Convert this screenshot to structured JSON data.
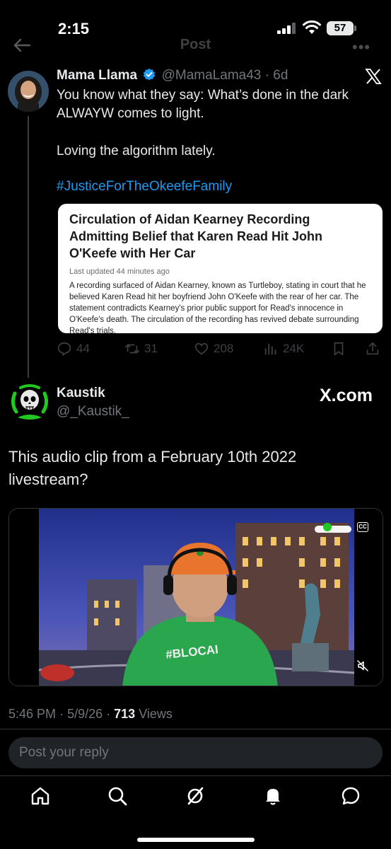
{
  "status_bar": {
    "time": "2:15",
    "battery": "57"
  },
  "topbar": {
    "title": "Post",
    "back_icon": "back-arrow-icon",
    "more_icon": "more-dots-icon"
  },
  "quoted_post": {
    "name": "Mama Llama",
    "handle": "@MamaLama43",
    "separator": "·",
    "age": "6d",
    "text_lines": [
      "You know what they say: What’s done in the dark",
      "ALWAYW comes to light."
    ],
    "text_2": "Loving the algorithm lately.",
    "hashtag": "#JusticeForTheOkeefeFamily",
    "card": {
      "title": "Circulation of Aidan Kearney Recording Admitting Belief that Karen Read Hit John O'Keefe with Her Car",
      "updated": "Last updated 44 minutes ago",
      "body": "A recording surfaced of Aidan Kearney, known as Turtleboy, stating in court that he believed Karen Read hit her boyfriend John O'Keefe with the rear of her car. The statement contradicts Kearney's prior public support for Read's innocence in O'Keefe's death. The circulation of the recording has revived debate surrounding Read's trials."
    },
    "actions": {
      "replies": "44",
      "reposts": "31",
      "likes": "208",
      "views": "24K"
    }
  },
  "main_post": {
    "name": "Kaustik",
    "handle": "@_Kaustik_",
    "source": "X.com",
    "text_lines": [
      "This audio clip from a February 10th 2022",
      "livestream?"
    ],
    "video": {
      "shirt_text": "#BLOCAI",
      "cc_label": "CC"
    },
    "time": "5:46 PM",
    "date": "5/9/26",
    "views_count": "713",
    "views_label": "Views",
    "separator": "·"
  },
  "reply": {
    "placeholder": "Post your reply"
  },
  "tabbar": {
    "items": [
      "home-icon",
      "search-icon",
      "grok-icon",
      "notifications-icon",
      "messages-icon"
    ]
  },
  "colors": {
    "background": "#000000",
    "text": "#e7e9ea",
    "muted": "#71767b",
    "accent": "#1d9bf0",
    "green": "#22c822"
  }
}
